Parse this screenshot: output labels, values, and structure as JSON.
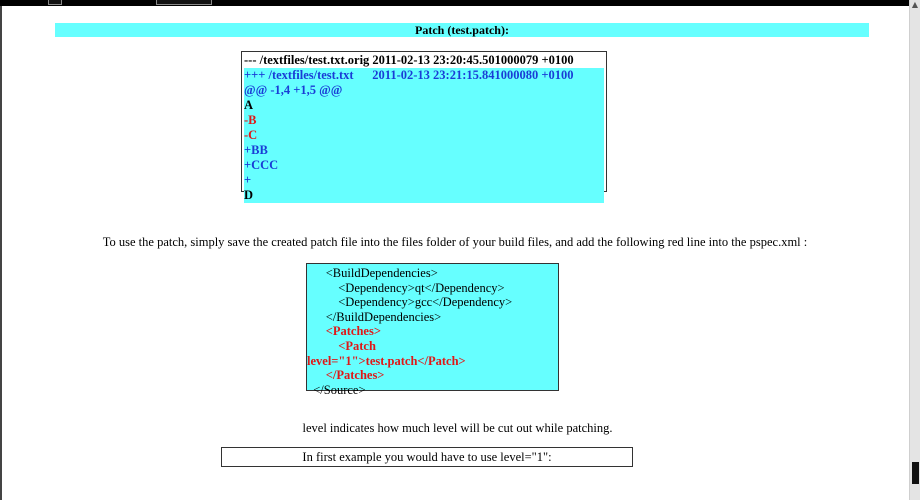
{
  "title": "Patch (test.patch):",
  "patch_lines": [
    {
      "text": "--- /textfiles/test.txt.orig 2011-02-13 23:20:45.501000079 +0100",
      "color": "black",
      "highlight": false
    },
    {
      "text": "+++ /textfiles/test.txt      2011-02-13 23:21:15.841000080 +0100",
      "color": "blue",
      "highlight": true
    },
    {
      "text": "@@ -1,4 +1,5 @@",
      "color": "blue",
      "highlight": true
    },
    {
      "text": "A",
      "color": "black",
      "highlight": true
    },
    {
      "text": "-B",
      "color": "red",
      "highlight": true
    },
    {
      "text": "-C",
      "color": "red",
      "highlight": true
    },
    {
      "text": "+BB",
      "color": "blue",
      "highlight": true
    },
    {
      "text": "+CCC",
      "color": "blue",
      "highlight": true
    },
    {
      "text": "+",
      "color": "blue",
      "highlight": true
    },
    {
      "text": "D",
      "color": "black",
      "highlight": true
    }
  ],
  "instruction": "To use the patch, simply save the created patch file into the files folder of your build files, and add the following red line into the pspec.xml :",
  "xml_lines": [
    {
      "text": "      <BuildDependencies>",
      "red": false
    },
    {
      "text": "          <Dependency>qt</Dependency>",
      "red": false
    },
    {
      "text": "          <Dependency>gcc</Dependency>",
      "red": false
    },
    {
      "text": "      </BuildDependencies>",
      "red": false
    },
    {
      "text": "      <Patches>",
      "red": true
    },
    {
      "text": "          <Patch",
      "red": true
    },
    {
      "text": "level=\"1\">test.patch</Patch>",
      "red": true
    },
    {
      "text": "      </Patches>",
      "red": true
    },
    {
      "text": "  </Source>",
      "red": false
    }
  ],
  "level_note": "level indicates how much level will be cut out while patching.",
  "example_note": "In first example you would have to use level=\"1\":",
  "colors": {
    "highlight_bg": "#66ffff",
    "blue_text": "#1a3dd6",
    "red_text": "#e01818"
  },
  "scrollbar": {
    "position_fraction": 0.94
  }
}
